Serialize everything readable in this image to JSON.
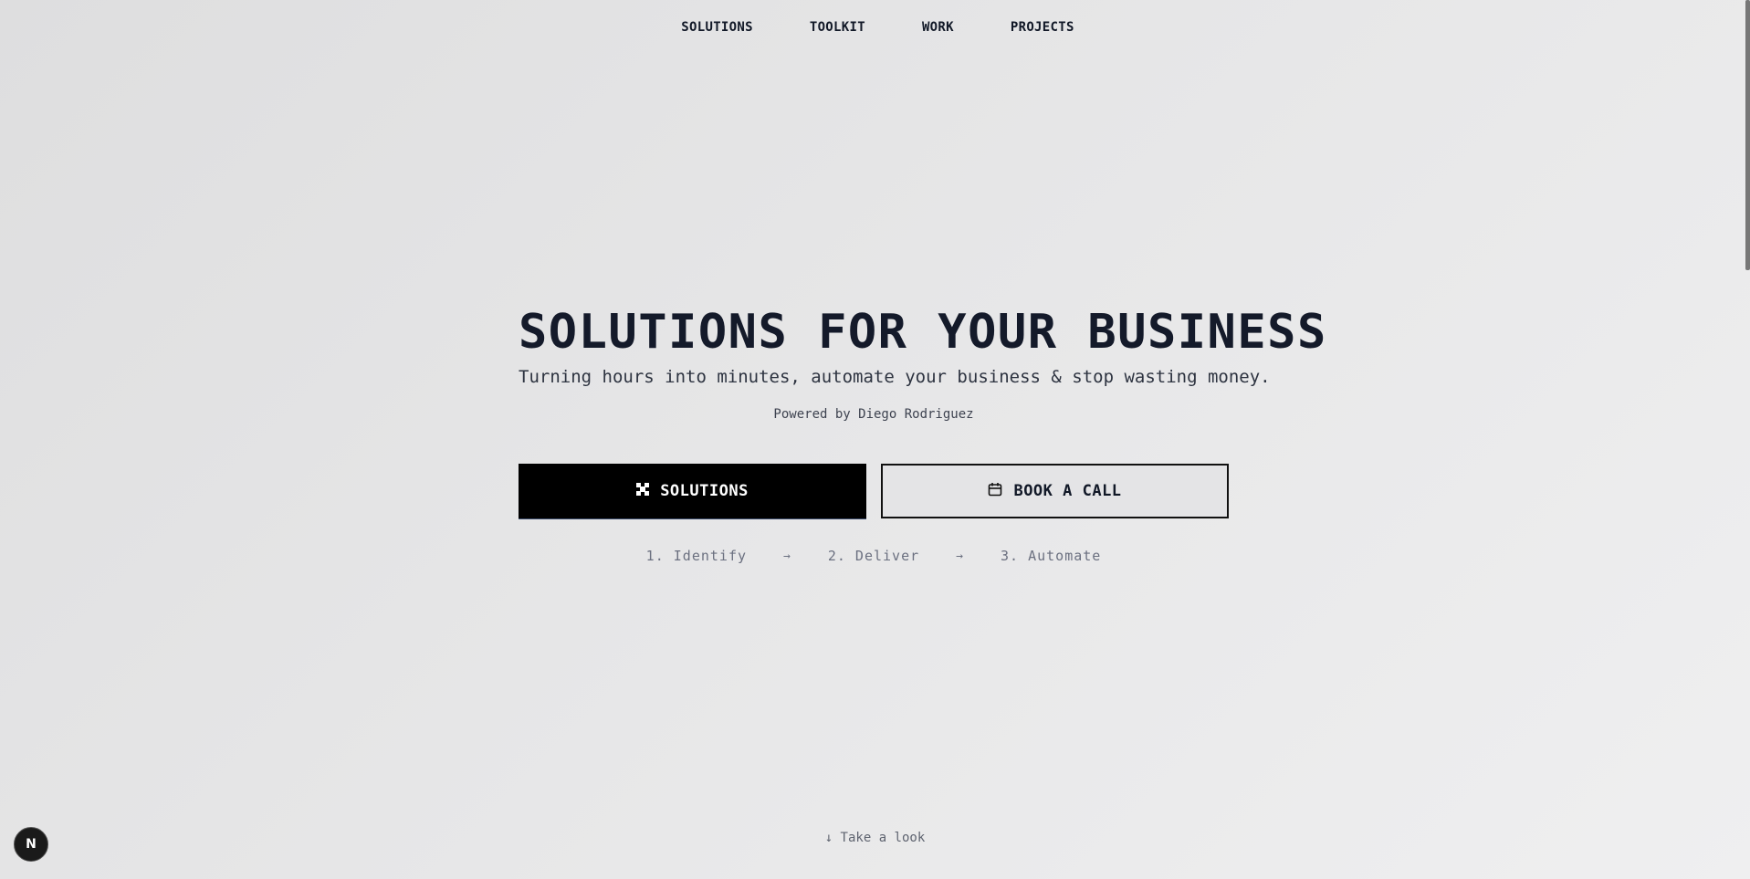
{
  "nav": {
    "items": [
      {
        "label": "SOLUTIONS"
      },
      {
        "label": "TOOLKIT"
      },
      {
        "label": "WORK"
      },
      {
        "label": "PROJECTS"
      }
    ]
  },
  "hero": {
    "title": "SOLUTIONS FOR YOUR BUSINESS",
    "subtitle": "Turning hours into minutes, automate your business & stop wasting money.",
    "powered_by": "Powered by Diego Rodriguez"
  },
  "buttons": {
    "primary": {
      "label": "SOLUTIONS",
      "icon": "puzzle-icon"
    },
    "secondary": {
      "label": "BOOK A CALL",
      "icon": "calendar-icon"
    }
  },
  "steps": {
    "items": [
      "1. Identify",
      "2. Deliver",
      "3. Automate"
    ],
    "separator": "→"
  },
  "scroll_hint": "↓ Take a look",
  "badge": {
    "label": "N",
    "icon": "nextjs-icon"
  },
  "colors": {
    "primary_button_bg": "#000000",
    "text": "#111827",
    "muted": "#6b7080"
  }
}
